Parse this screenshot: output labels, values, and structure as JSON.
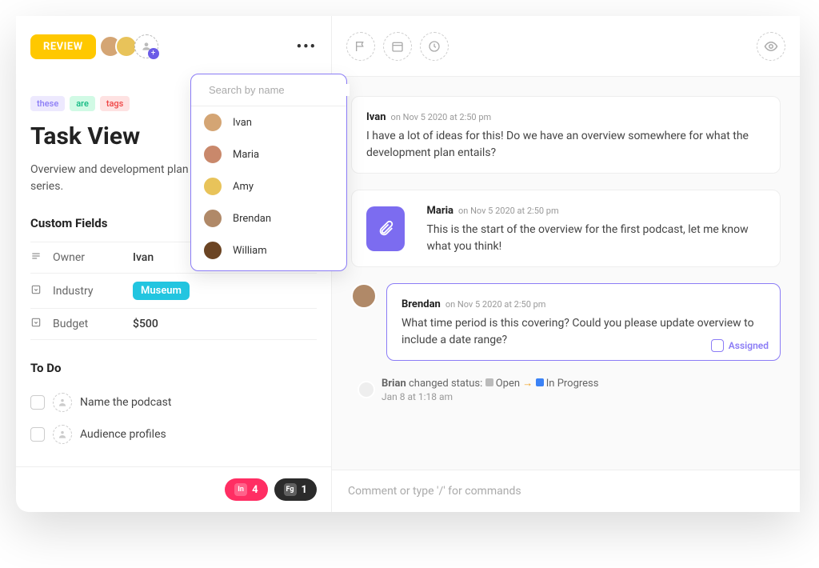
{
  "header": {
    "status_label": "REVIEW",
    "search_placeholder": "Search by name",
    "people": [
      {
        "name": "Ivan",
        "bg": "#d4a574"
      },
      {
        "name": "Maria",
        "bg": "#c9886b"
      },
      {
        "name": "Amy",
        "bg": "#e8c35a"
      },
      {
        "name": "Brendan",
        "bg": "#b08968"
      },
      {
        "name": "William",
        "bg": "#6b4423"
      }
    ]
  },
  "tags": [
    {
      "text": "these",
      "cls": "purple"
    },
    {
      "text": "are",
      "cls": "green"
    },
    {
      "text": "tags",
      "cls": "red"
    }
  ],
  "task": {
    "title": "Task View",
    "description": "Overview and development plan for our original podcast series."
  },
  "custom_fields": {
    "heading": "Custom Fields",
    "rows": [
      {
        "icon": "text",
        "label": "Owner",
        "value": "Ivan",
        "pill": false
      },
      {
        "icon": "dropdown",
        "label": "Industry",
        "value": "Museum",
        "pill": true
      },
      {
        "icon": "dropdown",
        "label": "Budget",
        "value": "$500",
        "pill": false
      }
    ]
  },
  "todo": {
    "heading": "To Do",
    "items": [
      "Name the podcast",
      "Audience profiles"
    ]
  },
  "footer_chips": [
    {
      "count": "4",
      "cls": "pink",
      "icon": "In"
    },
    {
      "count": "1",
      "cls": "dark",
      "icon": "Fg"
    }
  ],
  "comments": [
    {
      "author": "Ivan",
      "time": "on Nov 5 2020 at 2:50 pm",
      "text": "I have a lot of ideas for this! Do we have an overview somewhere for what the development plan entails?",
      "avatar_bg": "#d4a574"
    },
    {
      "author": "Maria",
      "time": "on Nov 5 2020 at 2:50 pm",
      "text": "This is the start of the overview for the first podcast, let me know what you think!",
      "attachment": true,
      "avatar_bg": "#c9886b"
    },
    {
      "author": "Brendan",
      "time": "on Nov 5 2020 at 2:50 pm",
      "text": "What time period is this covering? Could you please update overview to include a date range?",
      "purple": true,
      "assigned_label": "Assigned",
      "avatar_bg": "#b08968"
    }
  ],
  "activity": {
    "author": "Brian",
    "phrase": "changed status:",
    "from_label": "Open",
    "to_label": "In Progress",
    "from_color": "#bbb",
    "to_color": "#3b82f6",
    "time": "Jan 8 at 1:18 am"
  },
  "composer_placeholder": "Comment or type '/' for commands"
}
